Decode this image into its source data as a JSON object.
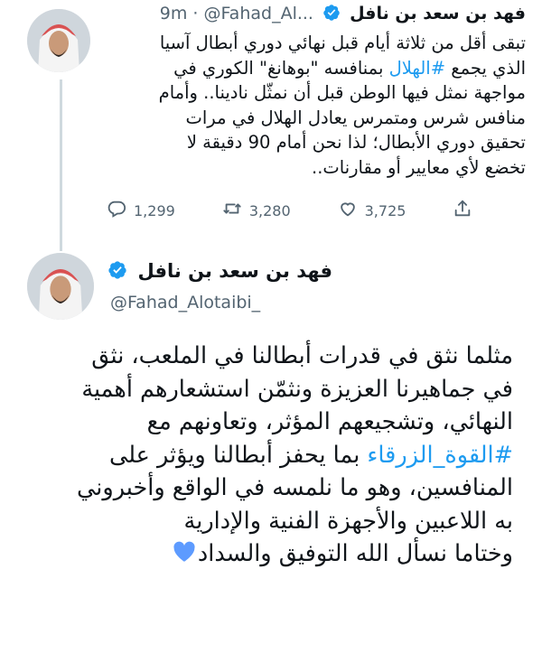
{
  "tweet_1": {
    "display_name": "فهد بن سعد بن نافل",
    "handle": "@Fahad_Al...",
    "separator": "·",
    "time": "9m",
    "text_lines": [
      "تبقى أقل من ثلاثة أيام قبل نهائي دوري أبطال آسيا",
      "مواجهة نمثل فيها الوطن قبل أن نمثّل نادينا.. وأمام",
      "منافس شرس ومتمرس يعادل الهلال في مرات",
      "تحقيق دوري الأبطال؛ لذا نحن أمام 90 دقيقة لا",
      "تخضع لأي معايير أو مقارنات.."
    ],
    "line2_before": "الذي يجمع ",
    "line2_hashtag": "#الهلال",
    "line2_after": " بمنافسه \"بوهانغ\" الكوري في",
    "stats": {
      "replies": "1,299",
      "retweets": "3,280",
      "likes": "3,725"
    },
    "icons": [
      "reply-icon",
      "retweet-icon",
      "like-icon",
      "share-icon"
    ]
  },
  "tweet_2": {
    "display_name": "فهد بن سعد بن نافل",
    "handle": "@Fahad_Alotaibi_",
    "text_lines": [
      "مثلما نثق في قدرات أبطالنا في الملعب، نثق",
      "في جماهيرنا العزيزة ونثمّن استشعارهم أهمية",
      "النهائي، وتشجيعهم المؤثر، وتعاونهم مع",
      "المنافسين، وهو ما نلمسه في الواقع وأخبروني",
      "به اللاعبين والأجهزة الفنية والإدارية",
      "وختاما نسأل الله التوفيق والسداد"
    ],
    "line4_hashtag": "#القوة_الزرقاء",
    "line4_after": " بما يحفز أبطالنا ويؤثر على",
    "emoji": "blue-heart",
    "icons": [
      "verified-badge-icon"
    ]
  },
  "colors": {
    "accent": "#1d9bf0",
    "secondary_text": "#536471",
    "primary_text": "#0f1419",
    "heart": "#5d9bff"
  }
}
